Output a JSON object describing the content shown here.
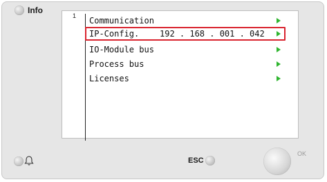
{
  "header": {
    "info_label": "Info",
    "page_number": "1"
  },
  "menu": {
    "items": [
      {
        "label": "Communication",
        "value": ""
      },
      {
        "label": "IP-Config.",
        "value": "192 . 168 . 001 . 042"
      },
      {
        "label": "IO-Module bus",
        "value": ""
      },
      {
        "label": "Process bus",
        "value": ""
      },
      {
        "label": "Licenses",
        "value": ""
      }
    ],
    "selected_index": 1
  },
  "footer": {
    "esc_label": "ESC",
    "ok_label": "OK"
  },
  "colors": {
    "arrow": "#2fb52f",
    "selection_border": "#d9232e",
    "bezel": "#e6e6e6"
  },
  "icons": {
    "info_led": "led-indicator-icon",
    "bell": "bell-icon",
    "esc_led": "led-indicator-icon",
    "arrow": "triangle-right-icon"
  }
}
